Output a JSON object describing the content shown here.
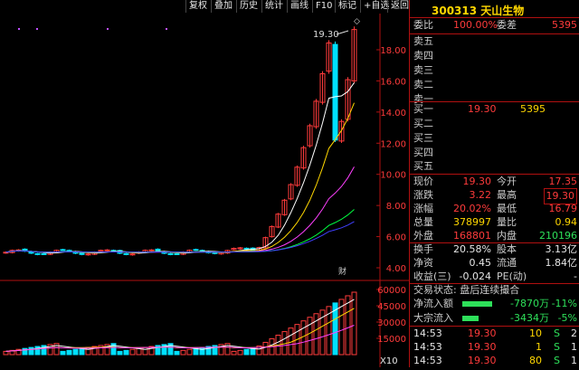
{
  "toolbar": {
    "buttons": [
      "复权",
      "叠加",
      "历史",
      "统计",
      "画线",
      "F10",
      "标记",
      "+自选",
      "返回"
    ]
  },
  "price_axis": [
    "18.00",
    "16.00",
    "14.00",
    "12.00",
    "10.00",
    "8.00",
    "6.00",
    "4.00"
  ],
  "volume_axis": [
    "60000",
    "45000",
    "30000",
    "15000"
  ],
  "vol_unit": "X10",
  "peak_label": "19.30",
  "event_tag": "财",
  "stock": {
    "code": "300313",
    "name": "天山生物"
  },
  "order_book": {
    "ratio_label": "委比",
    "ratio_value": "100.00%",
    "diff_label": "委差",
    "diff_value": "5395",
    "asks": [
      "卖五",
      "卖四",
      "卖三",
      "卖二",
      "卖一"
    ],
    "bids": [
      {
        "label": "买一",
        "price": "19.30",
        "vol": "5395"
      },
      {
        "label": "买二",
        "price": "",
        "vol": ""
      },
      {
        "label": "买三",
        "price": "",
        "vol": ""
      },
      {
        "label": "买四",
        "price": "",
        "vol": ""
      },
      {
        "label": "买五",
        "price": "",
        "vol": ""
      }
    ]
  },
  "quote": [
    {
      "l1": "现价",
      "v1": "19.30",
      "l2": "今开",
      "v2": "17.35"
    },
    {
      "l1": "涨跌",
      "v1": "3.22",
      "l2": "最高",
      "v2": "19.30"
    },
    {
      "l1": "涨幅",
      "v1": "20.02%",
      "l2": "最低",
      "v2": "16.79"
    },
    {
      "l1": "总量",
      "v1": "378997",
      "l2": "量比",
      "v2": "0.94"
    },
    {
      "l1": "外盘",
      "v1": "168801",
      "l2": "内盘",
      "v2": "210196"
    }
  ],
  "stats": [
    {
      "l1": "换手",
      "v1": "20.58%",
      "l2": "股本",
      "v2": "3.13亿"
    },
    {
      "l1": "净资",
      "v1": "0.45",
      "l2": "流通",
      "v2": "1.84亿"
    },
    {
      "l1": "收益(三)",
      "v1": "-0.024",
      "l2": "PE(动)",
      "v2": "-"
    }
  ],
  "status": "交易状态: 盘后连续撮合",
  "flows": [
    {
      "label": "净流入额",
      "value": "-7870万",
      "pct": "-11%",
      "bar": 0.55
    },
    {
      "label": "大宗流入",
      "value": "-3434万",
      "pct": "-5%",
      "bar": 0.3
    }
  ],
  "ticks": [
    {
      "time": "14:53",
      "price": "19.30",
      "vol": "10",
      "side": "S",
      "num": "2"
    },
    {
      "time": "14:53",
      "price": "19.30",
      "vol": "1",
      "side": "S",
      "num": "1"
    },
    {
      "time": "14:53",
      "price": "19.30",
      "vol": "80",
      "side": "S",
      "num": "1"
    }
  ],
  "colors": {
    "up": "#ff3b3b",
    "down": "#00e0ff",
    "ma5": "#ffffff",
    "ma10": "#ffd700",
    "ma20": "#ff40ff",
    "ma60": "#00ff40",
    "ma120": "#4040ff"
  }
}
